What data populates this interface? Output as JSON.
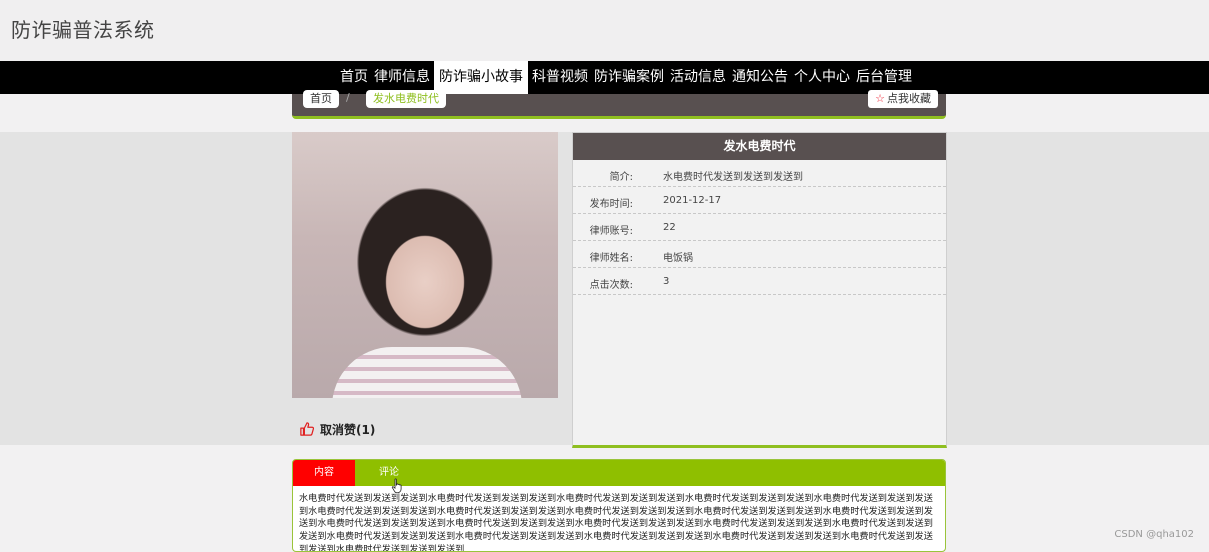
{
  "site": {
    "title": "防诈骗普法系统"
  },
  "nav": {
    "items": [
      {
        "label": "首页"
      },
      {
        "label": "律师信息"
      },
      {
        "label": "防诈骗小故事"
      },
      {
        "label": "科普视频"
      },
      {
        "label": "防诈骗案例"
      },
      {
        "label": "活动信息"
      },
      {
        "label": "通知公告"
      },
      {
        "label": "个人中心"
      },
      {
        "label": "后台管理"
      }
    ],
    "active_index": 2
  },
  "breadcrumb": {
    "home": "首页",
    "separator": "/",
    "current": "发水电费时代"
  },
  "favorite": {
    "label": "点我收藏"
  },
  "like": {
    "label": "取消赞(1)"
  },
  "detail": {
    "title": "发水电费时代",
    "rows": [
      {
        "label": "简介:",
        "value": "水电费时代发送到发送到发送到"
      },
      {
        "label": "发布时间:",
        "value": "2021-12-17"
      },
      {
        "label": "律师账号:",
        "value": "22"
      },
      {
        "label": "律师姓名:",
        "value": "电饭锅"
      },
      {
        "label": "点击次数:",
        "value": "3"
      }
    ]
  },
  "tabs": {
    "content_label": "内容",
    "comment_label": "评论"
  },
  "content": {
    "text": "水电费时代发送到发送到发送到水电费时代发送到发送到发送到水电费时代发送到发送到发送到水电费时代发送到发送到发送到水电费时代发送到发送到发送到水电费时代发送到发送到发送到水电费时代发送到发送到发送到水电费时代发送到发送到发送到水电费时代发送到发送到发送到水电费时代发送到发送到发送到水电费时代发送到发送到发送到水电费时代发送到发送到发送到水电费时代发送到发送到发送到水电费时代发送到发送到发送到水电费时代发送到发送到发送到水电费时代发送到发送到发送到水电费时代发送到发送到发送到水电费时代发送到发送到发送到水电费时代发送到发送到发送到水电费时代发送到发送到发送到水电费时代发送到发送到发送到"
  },
  "watermark": "CSDN @qha102",
  "colors": {
    "accent": "#8fbf00",
    "header_dark": "#585050",
    "tab_active": "#ff0000",
    "nav_bg": "#000000"
  }
}
